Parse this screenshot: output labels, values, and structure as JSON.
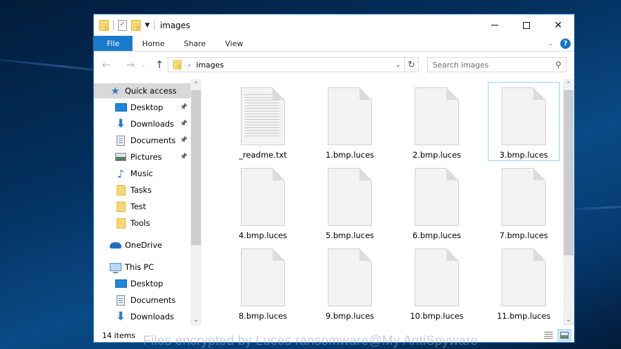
{
  "window": {
    "title": "images",
    "controls": {
      "minimize": "—",
      "maximize": "☐",
      "close": "✕"
    }
  },
  "ribbon": {
    "tabs": [
      {
        "label": "File",
        "active": true
      },
      {
        "label": "Home"
      },
      {
        "label": "Share"
      },
      {
        "label": "View"
      }
    ],
    "help_label": "?"
  },
  "navigation": {
    "back": "←",
    "forward": "→",
    "recent": "⌄",
    "up": "↑",
    "address_path": [
      "images"
    ],
    "refresh": "↻",
    "search_placeholder": "Search images"
  },
  "sidebar": {
    "items": [
      {
        "label": "Quick access",
        "icon": "star-icon",
        "level": 0,
        "selected": true
      },
      {
        "label": "Desktop",
        "icon": "desktop-icon",
        "level": 1,
        "pinned": true
      },
      {
        "label": "Downloads",
        "icon": "downloads-icon",
        "level": 1,
        "pinned": true
      },
      {
        "label": "Documents",
        "icon": "documents-icon",
        "level": 1,
        "pinned": true
      },
      {
        "label": "Pictures",
        "icon": "pictures-icon",
        "level": 1,
        "pinned": true
      },
      {
        "label": "Music",
        "icon": "music-icon",
        "level": 1
      },
      {
        "label": "Tasks",
        "icon": "folder-icon",
        "level": 1
      },
      {
        "label": "Test",
        "icon": "folder-icon",
        "level": 1
      },
      {
        "label": "Tools",
        "icon": "folder-icon",
        "level": 1
      },
      {
        "label": "OneDrive",
        "icon": "onedrive-icon",
        "level": 0
      },
      {
        "label": "This PC",
        "icon": "this-pc-icon",
        "level": 0
      },
      {
        "label": "Desktop",
        "icon": "desktop-icon",
        "level": 1
      },
      {
        "label": "Documents",
        "icon": "documents-icon",
        "level": 1
      },
      {
        "label": "Downloads",
        "icon": "downloads-icon",
        "level": 1
      }
    ]
  },
  "files": [
    {
      "name": "_readme.txt",
      "type": "text"
    },
    {
      "name": "1.bmp.luces",
      "type": "blank"
    },
    {
      "name": "2.bmp.luces",
      "type": "blank"
    },
    {
      "name": "3.bmp.luces",
      "type": "blank",
      "selected": true
    },
    {
      "name": "4.bmp.luces",
      "type": "blank"
    },
    {
      "name": "5.bmp.luces",
      "type": "blank"
    },
    {
      "name": "6.bmp.luces",
      "type": "blank"
    },
    {
      "name": "7.bmp.luces",
      "type": "blank"
    },
    {
      "name": "8.bmp.luces",
      "type": "blank"
    },
    {
      "name": "9.bmp.luces",
      "type": "blank"
    },
    {
      "name": "10.bmp.luces",
      "type": "blank"
    },
    {
      "name": "11.bmp.luces",
      "type": "blank"
    }
  ],
  "status": {
    "item_count": "14 items"
  },
  "watermark": "Files encrypted by Luces ransomware@My AntiSpyware"
}
